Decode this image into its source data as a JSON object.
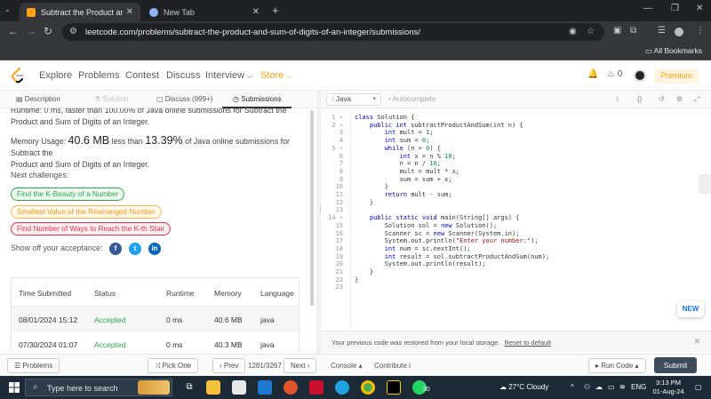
{
  "browser": {
    "tabs": [
      {
        "title": "Subtract the Product and Sum o",
        "active": true
      },
      {
        "title": "New Tab",
        "active": false
      }
    ],
    "url": "leetcode.com/problems/subtract-the-product-and-sum-of-digits-of-an-integer/submissions/",
    "all_bookmarks": "All Bookmarks"
  },
  "nav": {
    "items": [
      "Explore",
      "Problems",
      "Contest",
      "Discuss",
      "Interview",
      "Store"
    ],
    "coins": "0",
    "premium": "Premium"
  },
  "left_tabs": [
    "Description",
    "Solution",
    "Discuss (999+)",
    "Submissions"
  ],
  "submission": {
    "runtime_partial": "Runtime: 0 ms, faster than 100.00% of Java online submissions for Subtract the",
    "runtime_line2": "Product and Sum of Digits of an Integer.",
    "memory_label": "Memory Usage:",
    "memory_value": "40.6 MB",
    "memory_mid": "less than",
    "memory_pct": "13.39%",
    "memory_tail": "of Java online submissions for Subtract the",
    "memory_line2": "Product and Sum of Digits of an Integer.",
    "next_challenges": "Next challenges:",
    "challenges": [
      "Find the K-Beauty of a Number",
      "Smallest Value of the Rearranged Number",
      "Find Number of Ways to Reach the K-th Stair"
    ],
    "share": "Show off your acceptance:"
  },
  "table": {
    "headers": [
      "Time Submitted",
      "Status",
      "Runtime",
      "Memory",
      "Language"
    ],
    "rows": [
      [
        "08/01/2024 15:12",
        "Accepted",
        "0 ms",
        "40.6 MB",
        "java"
      ],
      [
        "07/30/2024 01:07",
        "Accepted",
        "0 ms",
        "40.3 MB",
        "java"
      ]
    ]
  },
  "editor": {
    "language": "Java",
    "autocomplete": "Autocomplete",
    "restore_msg": "Your previous code was restored from your local storage.",
    "reset": "Reset to default",
    "new_badge": "NEW"
  },
  "bottom": {
    "problems": "Problems",
    "pick_one": "Pick One",
    "prev": "Prev",
    "counter": "1281/3267",
    "next": "Next",
    "console": "Console",
    "contribute": "Contribute",
    "run_code": "Run Code",
    "submit": "Submit"
  },
  "taskbar": {
    "search": "Type here to search",
    "badge": "30",
    "weather": "27°C  Cloudy",
    "lang": "ENG",
    "time": "3:13 PM",
    "date": "01-Aug-24"
  }
}
